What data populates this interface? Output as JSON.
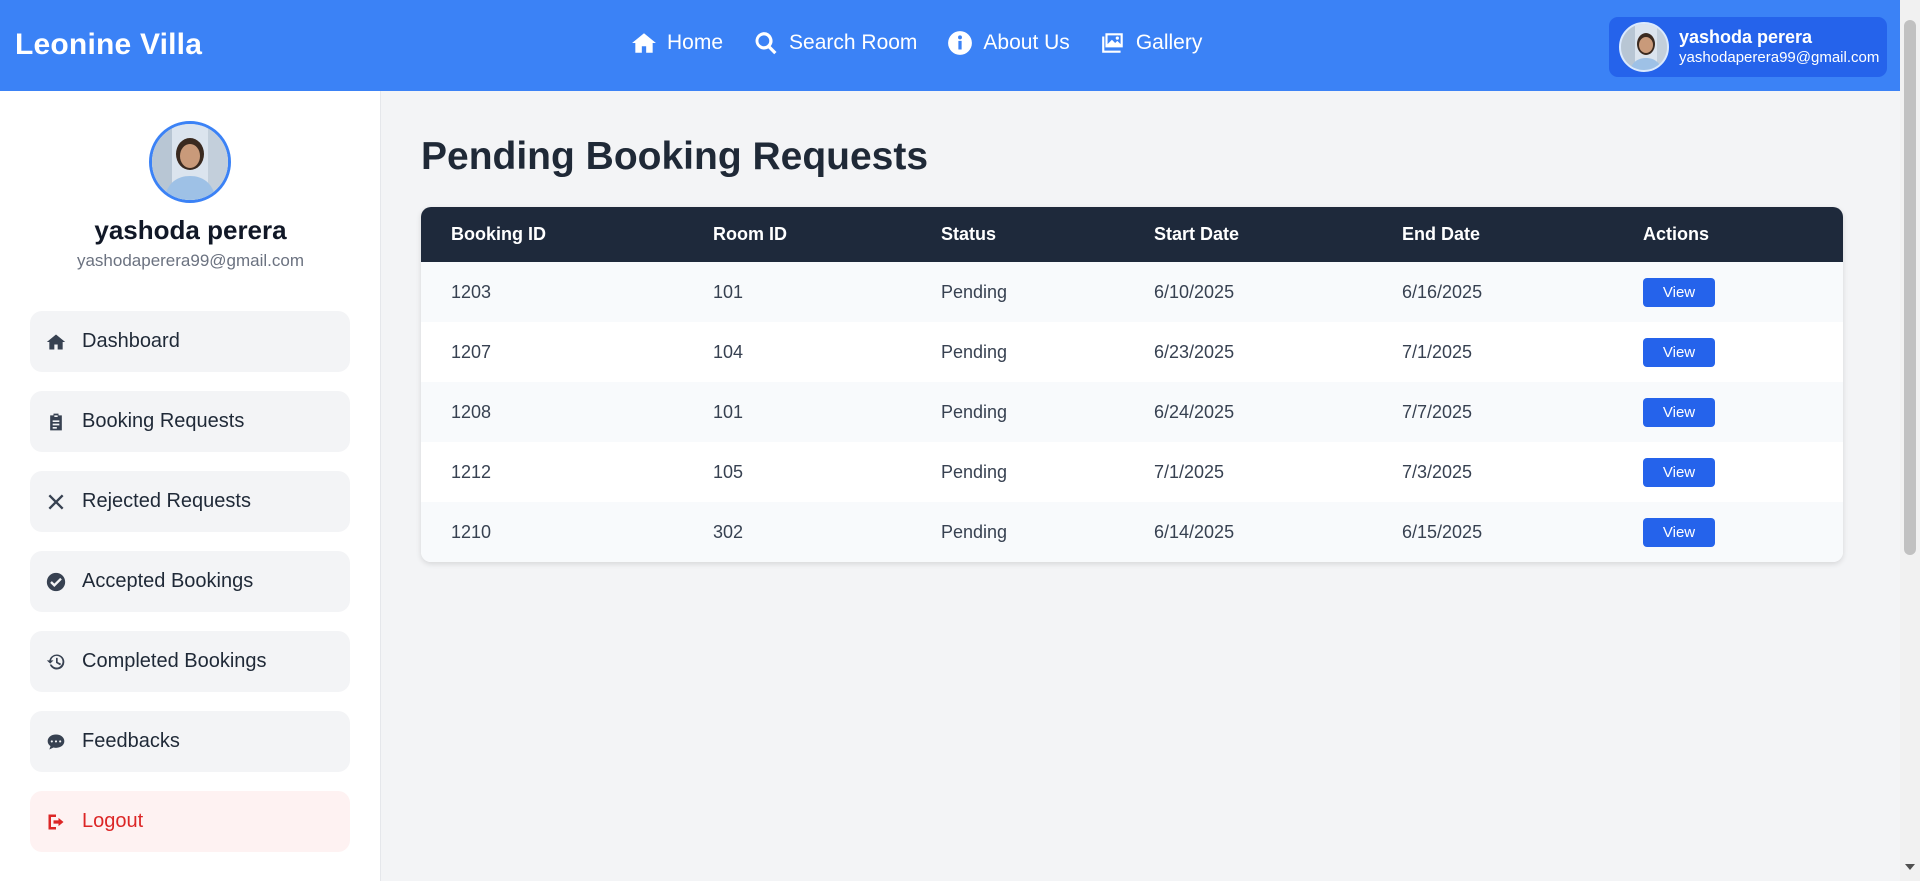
{
  "header": {
    "brand": "Leonine Villa",
    "nav": [
      {
        "label": "Home",
        "icon": "home-icon"
      },
      {
        "label": "Search Room",
        "icon": "search-icon"
      },
      {
        "label": "About Us",
        "icon": "info-icon"
      },
      {
        "label": "Gallery",
        "icon": "gallery-icon"
      }
    ],
    "user": {
      "name": "yashoda perera",
      "email": "yashodaperera99@gmail.com"
    }
  },
  "sidebar": {
    "profile": {
      "name": "yashoda perera",
      "email": "yashodaperera99@gmail.com"
    },
    "items": [
      {
        "label": "Dashboard",
        "icon": "home-icon"
      },
      {
        "label": "Booking Requests",
        "icon": "clipboard-icon"
      },
      {
        "label": "Rejected Requests",
        "icon": "x-icon"
      },
      {
        "label": "Accepted Bookings",
        "icon": "check-circle-icon"
      },
      {
        "label": "Completed Bookings",
        "icon": "history-icon"
      },
      {
        "label": "Feedbacks",
        "icon": "comment-icon"
      },
      {
        "label": "Logout",
        "icon": "logout-icon"
      }
    ]
  },
  "main": {
    "title": "Pending Booking Requests",
    "table": {
      "headers": [
        "Booking ID",
        "Room ID",
        "Status",
        "Start Date",
        "End Date",
        "Actions"
      ],
      "rows": [
        {
          "booking_id": "1203",
          "room_id": "101",
          "status": "Pending",
          "start": "6/10/2025",
          "end": "6/16/2025",
          "action": "View"
        },
        {
          "booking_id": "1207",
          "room_id": "104",
          "status": "Pending",
          "start": "6/23/2025",
          "end": "7/1/2025",
          "action": "View"
        },
        {
          "booking_id": "1208",
          "room_id": "101",
          "status": "Pending",
          "start": "6/24/2025",
          "end": "7/7/2025",
          "action": "View"
        },
        {
          "booking_id": "1212",
          "room_id": "105",
          "status": "Pending",
          "start": "7/1/2025",
          "end": "7/3/2025",
          "action": "View"
        },
        {
          "booking_id": "1210",
          "room_id": "302",
          "status": "Pending",
          "start": "6/14/2025",
          "end": "6/15/2025",
          "action": "View"
        }
      ]
    }
  },
  "colors": {
    "header_bg": "#3b82f6",
    "table_head_bg": "#1e293b",
    "button": "#2563eb",
    "logout": "#dc2626"
  }
}
